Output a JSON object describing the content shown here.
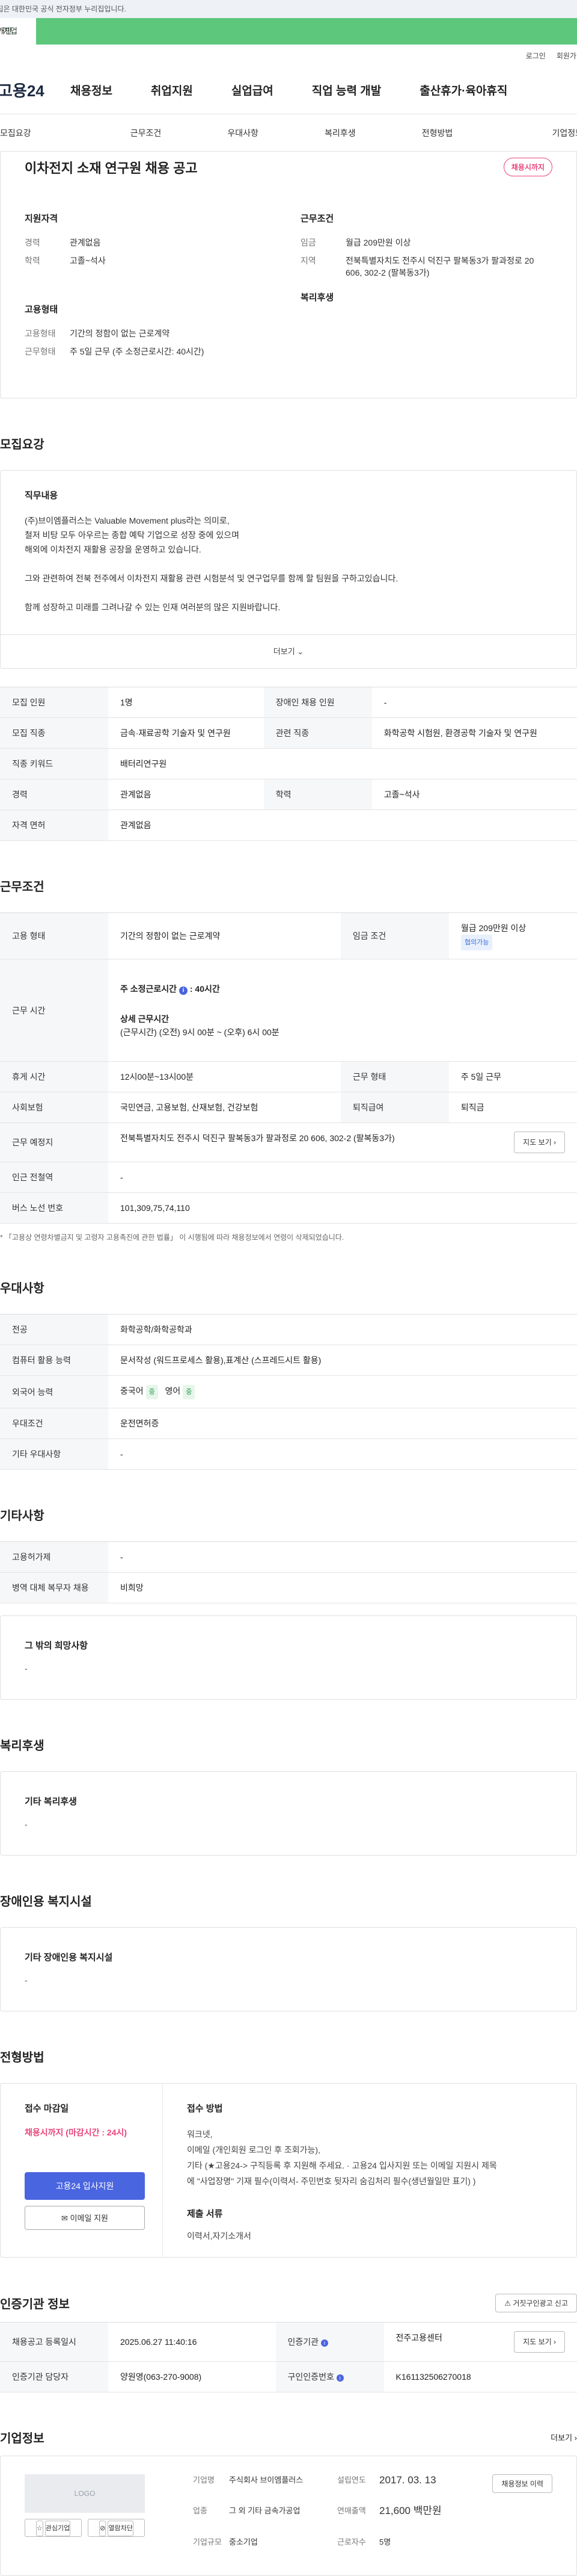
{
  "gov_banner": "이 누리집은 대한민국 공식 전자정부 누리집입니다.",
  "type_tabs": {
    "individual": "개인",
    "corporate": "기업"
  },
  "util": {
    "login": "로그인",
    "signup": "회원가입"
  },
  "gnb": {
    "logo": "고용24",
    "menus": [
      "채용정보",
      "취업지원",
      "실업급여",
      "직업 능력 개발",
      "출산휴가·육아휴직"
    ]
  },
  "anchors": [
    "모집요강",
    "근무조건",
    "우대사항",
    "복리후생",
    "전형방법",
    "기업정보"
  ],
  "summary": {
    "title": "이차전지 소재 연구원 채용 공고",
    "badge": "채용시까지",
    "qual_title": "지원자격",
    "qual": [
      {
        "k": "경력",
        "v": "관계없음"
      },
      {
        "k": "학력",
        "v": "고졸~석사"
      }
    ],
    "cond_title": "근무조건",
    "cond": [
      {
        "k": "임금",
        "v": "월급 209만원 이상"
      },
      {
        "k": "지역",
        "v": "전북특별자치도 전주시 덕진구 팔복동3가 팔과정로 20 606, 302-2 (팔복동3가)"
      }
    ],
    "emp_title": "고용형태",
    "emp": [
      {
        "k": "고용형태",
        "v": "기간의 정함이 없는 근로계약"
      },
      {
        "k": "근무형태",
        "v": "주 5일 근무 (주 소정근로시간: 40시간)"
      }
    ],
    "welfare_title": "복리후생"
  },
  "recruit": {
    "title": "모집요강",
    "desc_title": "직무내용",
    "desc_lines": [
      "(주)브이엠플러스는 Valuable Movement plus라는 의미로,",
      "철저 비탕 모두 아우르는 종합 예탁 기업으로 성장 중에 있으며",
      "해외에 이차전지 재활용 공장을 운영하고 있습니다.",
      "",
      "그와 관련하여 전북 전주에서 이차전지 재활용 관련 시험분석 및 연구업무를 함께 할 팀원을 구하고있습니다.",
      "",
      "함께 성장하고 미래를 그려나갈 수 있는 인재 여러분의 많은 지원바랍니다."
    ],
    "more": "더보기",
    "rows": [
      {
        "k1": "모집 인원",
        "v1": "1명",
        "k2": "장애인 채용 인원",
        "v2": "-"
      },
      {
        "k1": "모집 직종",
        "v1": "금속·재료공학 기술자 및 연구원",
        "k2": "관련 직종",
        "v2": "화학공학 시험원, 환경공학 기술자 및 연구원"
      },
      {
        "k1": "직종 키워드",
        "v1": "배터리연구원"
      },
      {
        "k1": "경력",
        "v1": "관계없음",
        "k2": "학력",
        "v2": "고졸~석사"
      },
      {
        "k1": "자격 면허",
        "v1": "관계없음"
      }
    ]
  },
  "work": {
    "title": "근무조건",
    "emp_type_k": "고용 형태",
    "emp_type_v": "기간의 정함이 없는 근로계약",
    "wage_k": "임금 조건",
    "wage_v": "월급 209만원 이상",
    "wage_chip": "협의가능",
    "hours_k": "근무 시간",
    "hours_total": "주 소정근로시간",
    "hours_total_v": "40시간",
    "hours_detail_title": "상세 근무시간",
    "hours_detail": "(근무시간) (오전) 9시 00분 ~ (오후) 6시 00분",
    "break_k": "휴게 시간",
    "break_v": "12시00분~13시00분",
    "shift_k": "근무 형태",
    "shift_v": "주 5일 근무",
    "ins_k": "사회보험",
    "ins_v": "국민연금, 고용보험, 산재보험, 건강보험",
    "ret_k": "퇴직급여",
    "ret_v": "퇴직금",
    "loc_k": "근무 예정지",
    "loc_v": "전북특별자치도 전주시 덕진구 팔복동3가 팔과정로 20 606, 302-2 (팔복동3가)",
    "map_btn": "지도 보기",
    "subway_k": "인근 전철역",
    "subway_v": "-",
    "bus_k": "버스 노선 번호",
    "bus_v": "101,309,75,74,110",
    "note": "* 「고용상 연령차별금지 및 고령자 고용촉진에 관한 법률」 이 시행됨에 따라 채용정보에서 연령이 삭제되었습니다."
  },
  "pref": {
    "title": "우대사항",
    "major_k": "전공",
    "major_v": "화학공학/화학공학과",
    "pc_k": "컴퓨터 활용 능력",
    "pc_v": "문서작성 (워드프로세스 활용),표계산 (스프레드시트 활용)",
    "lang_k": "외국어 능력",
    "lang_1": "중국어",
    "lang_1_lvl": "중",
    "lang_2": "영어",
    "lang_2_lvl": "중",
    "cond_k": "우대조건",
    "cond_v": "운전면허증",
    "etc_k": "기타 우대사항",
    "etc_v": "-"
  },
  "etc": {
    "title": "기타사항",
    "welfare_k": "고용허가제",
    "welfare_v": "-",
    "army_k": "병역 대체 복무자 채용",
    "army_v": "비희망",
    "other_title": "그 밖의 희망사항",
    "other_v": "-"
  },
  "benefit": {
    "title": "복리후생",
    "box_title": "기타 복리후생",
    "box_v": "-"
  },
  "disabled": {
    "title": "장애인용 복지시설",
    "box_title": "기타 장애인용 복지시설",
    "box_v": "-"
  },
  "apply": {
    "title": "전형방법",
    "deadline_title": "접수 마감일",
    "deadline_v": "채용시까지 (마감시간 : 24시)",
    "apply_btn": "고용24 입사지원",
    "email_btn": "이메일 지원",
    "method_title": "접수 방법",
    "method_lines": [
      "워크넷,",
      "이메일 (개인회원 로그인 후 조회가능),",
      "기타 (★고용24-> 구직등록 후 지원해 주세요. · 고용24 입사지원 또는  이메일 지원시 제목",
      "에 \"사업장명\" 기재 필수(이력서- 주민번호 뒷자리 숨김처리 필수(생년월일만 표기) )"
    ],
    "docs_title": "제출 서류",
    "docs_v": "이력서,자기소개서"
  },
  "agency": {
    "title": "인증기관 정보",
    "report_btn": "거짓구인광고 신고",
    "reg_k": "채용공고 등록일시",
    "reg_v": "2025.06.27 11:40:16",
    "org_k": "인증기관",
    "org_v": "전주고용센터",
    "map_btn": "지도 보기",
    "mgr_k": "인증기관 담당자",
    "mgr_v": "양원영(063-270-9008)",
    "num_k": "구인인증번호",
    "num_v": "K161132506270018"
  },
  "company": {
    "title": "기업정보",
    "more": "더보기",
    "logo": "LOGO",
    "fav_btn": "관심기업",
    "view_btn": "열람차단",
    "name_k": "기업명",
    "name_v": "주식회사 브이엠플러스",
    "est_k": "설립연도",
    "est_v": "2017. 03. 13",
    "ind_k": "업종",
    "ind_v": "그 외 기타 금속가공업",
    "sales_k": "연매출액",
    "sales_v": "21,600 백만원",
    "size_k": "기업규모",
    "size_v": "중소기업",
    "emp_k": "근로자수",
    "emp_v": "5명",
    "recruit_btn": "채용정보 이력"
  }
}
